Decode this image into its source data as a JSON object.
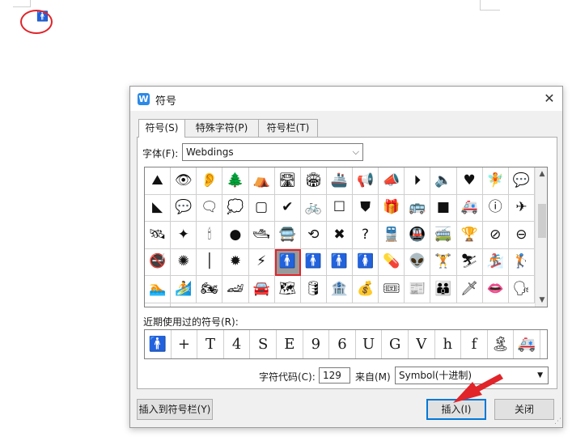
{
  "document": {
    "cursor_symbol": "🚹"
  },
  "dialog": {
    "title": "符号",
    "close": "✕",
    "tabs": [
      {
        "label": "符号(S)",
        "active": true
      },
      {
        "label": "特殊字符(P)",
        "active": false
      },
      {
        "label": "符号栏(T)",
        "active": false
      }
    ],
    "font_label": "字体(F):",
    "font_value": "Webdings",
    "symbols": [
      "⛰",
      "👁",
      "👂",
      "🌲",
      "⛺",
      "🛣",
      "🏟",
      "🚢",
      "📢",
      "📣",
      "⏵",
      "🔈",
      "♥",
      "🧚",
      "💬",
      "◣",
      "💬",
      "🗨",
      "💭",
      "▢",
      "✔",
      "🚲",
      "☐",
      "⛊",
      "🎁",
      "🚌",
      "■",
      "🚑",
      "ⓘ",
      "✈",
      "🛰",
      "✦",
      "🕯",
      "●",
      "🛥",
      "🚍",
      "⟲",
      "✖",
      "?",
      "🚆",
      "🚇",
      "🚎",
      "🏆",
      "⊘",
      "⊖",
      "🚭",
      "✺",
      "│",
      "✹",
      "⚡",
      "🚹",
      "🚹",
      "🚹",
      "🚺",
      "💊",
      "👽",
      "🏋",
      "⛷",
      "🏂",
      "🏌",
      "🏊",
      "🏄",
      "🏍",
      "🏎",
      "🚘",
      "🗺",
      "🛢",
      "🏦",
      "💰",
      "🎟",
      "📰",
      "👪",
      "🗡",
      "👄",
      "🗣",
      "✯"
    ],
    "selected_index": 50,
    "recent_label": "近期使用过的符号(R):",
    "recent": [
      "🚹",
      "+",
      "T",
      "4",
      "S",
      "E",
      "9",
      "6",
      "U",
      "G",
      "V",
      "h",
      "f",
      "🏝",
      "🚑"
    ],
    "code_label": "字符代码(C):",
    "code_value": "129",
    "from_label": "来自(M)",
    "from_value": "Symbol(十进制)",
    "buttons": {
      "add_to_toolbar": "插入到符号栏(Y)",
      "insert": "插入(I)",
      "close": "关闭"
    }
  },
  "colors": {
    "accent": "#0078d7",
    "annotation": "#e0242a",
    "app_icon": "#2b89e8"
  }
}
